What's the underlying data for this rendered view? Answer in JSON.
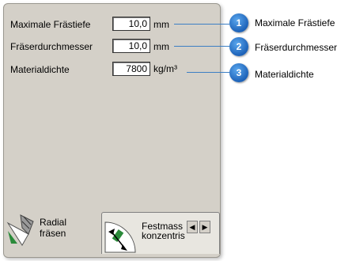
{
  "fields": [
    {
      "label": "Maximale Frästiefe",
      "value": "10,0",
      "unit": "mm"
    },
    {
      "label": "Fräserdurchmesser",
      "value": "10,0",
      "unit": "mm"
    },
    {
      "label": "Materialdichte",
      "value": "7800",
      "unit": "kg/m³"
    }
  ],
  "callouts": [
    {
      "number": "1",
      "text": "Maximale Frästiefe"
    },
    {
      "number": "2",
      "text": "Fräserdurchmesser"
    },
    {
      "number": "3",
      "text": "Materialdichte"
    }
  ],
  "tabs": {
    "radial": {
      "line1": "Radial",
      "line2": "fräsen"
    },
    "festmass": {
      "line1": "Festmass",
      "line2": "konzentris"
    }
  },
  "scroll": {
    "left": "◀",
    "right": "▶"
  },
  "colors": {
    "panel": "#d4d0c8",
    "callout": "#1d62b8"
  }
}
